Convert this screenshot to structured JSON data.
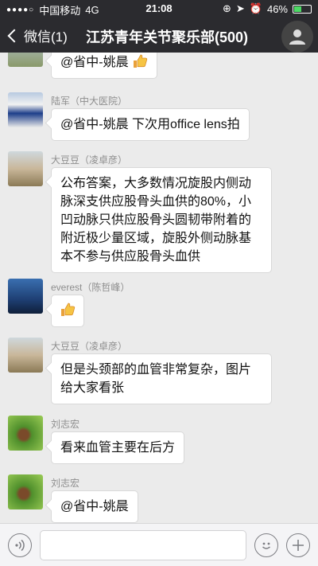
{
  "status": {
    "carrier": "中国移动",
    "network": "4G",
    "time": "21:08",
    "battery": "46%",
    "battery_level": 0.46
  },
  "nav": {
    "back_label": "微信(1)",
    "title": "江苏青年关节聚乐部(500)"
  },
  "messages": [
    {
      "sender": "",
      "text": "@省中-姚晨 ",
      "has_thumb": true
    },
    {
      "sender": "陆军（中大医院）",
      "text": "@省中-姚晨 下次用office lens拍"
    },
    {
      "sender": "大豆豆（凌卓彦）",
      "lines": [
        "公布答案，大多数情况旋股内侧动",
        "脉深支供应股骨头血供的80%，小",
        "凹动脉只供应股骨头圆韧带附着的",
        "附近极少量区域，旋股外侧动脉基",
        "本不参与供应股骨头血供"
      ]
    },
    {
      "sender": "everest（陈哲峰）",
      "text": "",
      "has_thumb": true
    },
    {
      "sender": "大豆豆（凌卓彦）",
      "lines": [
        "但是头颈部的血管非常复杂，图片",
        "给大家看张"
      ]
    },
    {
      "sender": "刘志宏",
      "text": "看来血管主要在后方"
    },
    {
      "sender": "刘志宏",
      "text": "@省中-姚晨"
    }
  ],
  "colors": {
    "nav_bg": "#2b2b2f",
    "chat_bg": "#ebebeb"
  }
}
